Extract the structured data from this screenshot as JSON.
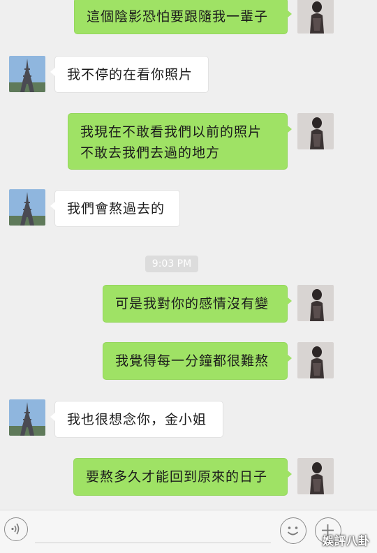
{
  "messages": [
    {
      "side": "out",
      "lines": [
        "這個陰影恐怕要跟隨我一輩子"
      ]
    },
    {
      "side": "in",
      "lines": [
        "我不停的在看你照片"
      ]
    },
    {
      "side": "out",
      "lines": [
        "我現在不敢看我們以前的照片",
        "不敢去我們去過的地方"
      ]
    },
    {
      "side": "in",
      "lines": [
        "我們會熬過去的"
      ]
    },
    {
      "side": "out",
      "lines": [
        "可是我對你的感情沒有變"
      ]
    },
    {
      "side": "out",
      "lines": [
        "我覺得每一分鐘都很難熬"
      ]
    },
    {
      "side": "in",
      "lines": [
        "我也很想念你，金小姐"
      ]
    },
    {
      "side": "out",
      "lines": [
        "要熬多久才能回到原來的日子"
      ]
    }
  ],
  "timestamp": "9:03 PM",
  "icons": {
    "contact_avatar": "eiffel-tower-photo",
    "self_avatar": "woman-portrait-photo",
    "voice": "voice-icon",
    "emoji": "emoji-icon",
    "more": "plus-icon"
  },
  "watermark": "娛評八卦",
  "colors": {
    "background": "#efefef",
    "outgoing_bubble": "#9fe265",
    "incoming_bubble": "#ffffff",
    "timestamp_bg": "#dcdcdc"
  }
}
